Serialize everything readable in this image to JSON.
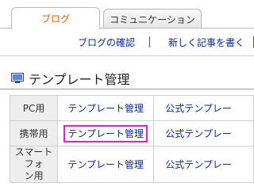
{
  "tabs": [
    {
      "label": "ブログ",
      "active": true
    },
    {
      "label": "コミュニケーション",
      "active": false
    }
  ],
  "subnav": {
    "links": [
      "ブログの確認",
      "新しく記事を書く"
    ]
  },
  "section": {
    "title": "テンプレート管理",
    "icon": "monitor-icon"
  },
  "table": {
    "rows": [
      {
        "label": "PC用",
        "col1": "テンプレート管理",
        "col2": "公式テンプレー"
      },
      {
        "label": "携帯用",
        "col1": "テンプレート管理",
        "col2": "公式テンプレー",
        "highlighted": true
      },
      {
        "label": "スマートフォン用",
        "label_lines": [
          "スマートフォ",
          "ン用"
        ],
        "col1": "テンプレート管理",
        "col2": "公式テンプレー"
      }
    ]
  },
  "colors": {
    "active_tab_text": "#d36400",
    "link": "#0a2a9c",
    "highlight_border": "#e020c8"
  }
}
